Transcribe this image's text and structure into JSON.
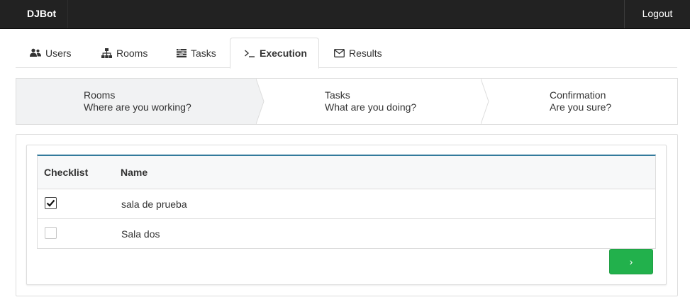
{
  "navbar": {
    "brand": "DJBot",
    "logout_label": "Logout"
  },
  "tabs": [
    {
      "label": "Users",
      "icon": "users-icon",
      "active": false
    },
    {
      "label": "Rooms",
      "icon": "sitemap-icon",
      "active": false
    },
    {
      "label": "Tasks",
      "icon": "tasks-icon",
      "active": false
    },
    {
      "label": "Execution",
      "icon": "terminal-icon",
      "active": true
    },
    {
      "label": "Results",
      "icon": "envelope-icon",
      "active": false
    }
  ],
  "wizard": {
    "steps": [
      {
        "title": "Rooms",
        "subtitle": "Where are you working?",
        "active": true
      },
      {
        "title": "Tasks",
        "subtitle": "What are you doing?",
        "active": false
      },
      {
        "title": "Confirmation",
        "subtitle": "Are you sure?",
        "active": false
      }
    ]
  },
  "table": {
    "headers": {
      "checklist": "Checklist",
      "name": "Name"
    },
    "rows": [
      {
        "checked": true,
        "name": "sala de prueba"
      },
      {
        "checked": false,
        "name": "Sala dos"
      }
    ]
  },
  "next_button": {
    "label": "›",
    "icon": "chevron-right-icon"
  },
  "colors": {
    "navbar_bg": "#222222",
    "accent_border": "#337a9c",
    "next_button_bg": "#22b14c",
    "active_step_bg": "#f1f2f3"
  }
}
